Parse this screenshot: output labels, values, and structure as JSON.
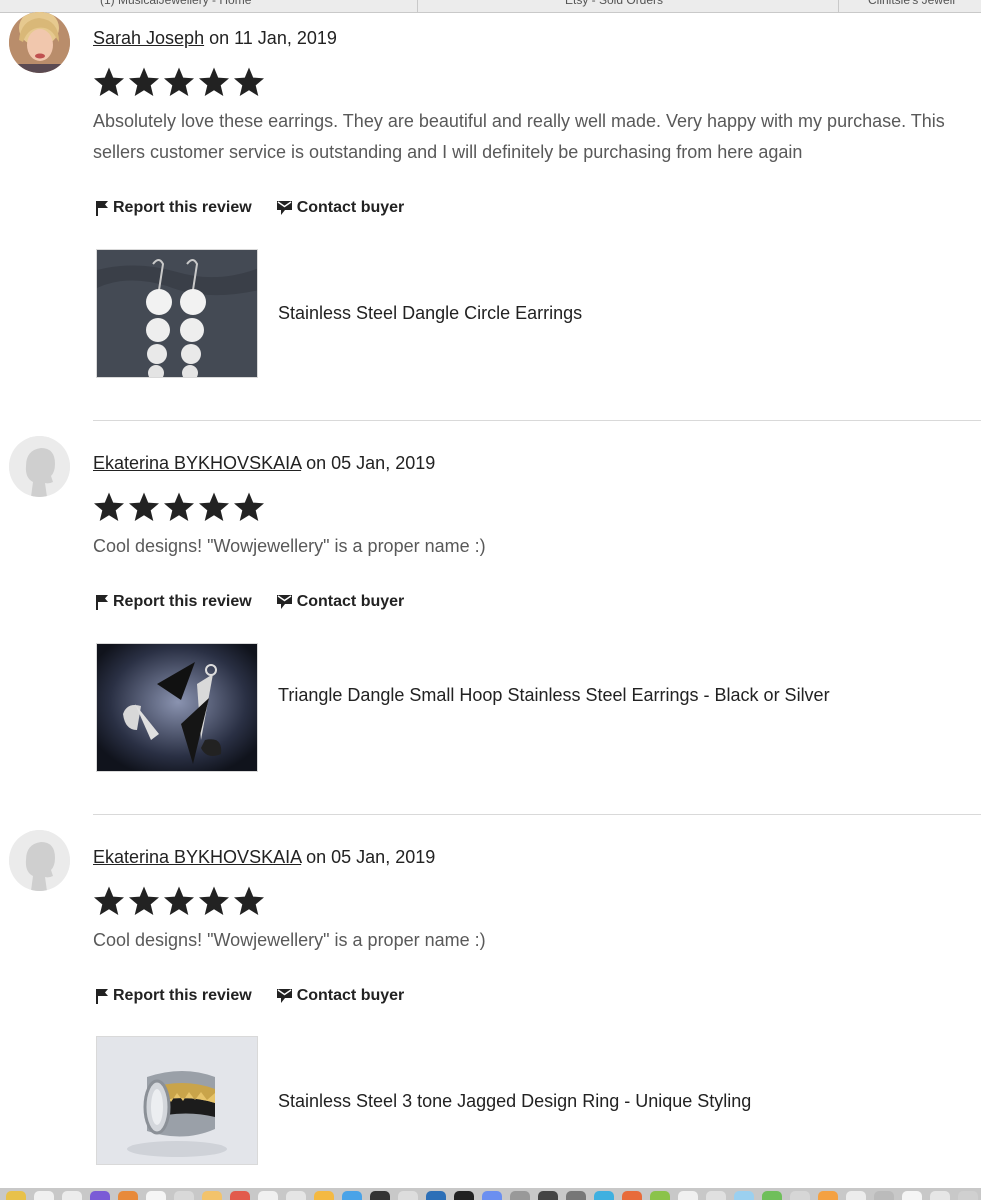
{
  "browser": {
    "tabs": [
      {
        "label": "(1) MusicalJewellery - Home"
      },
      {
        "label": "Etsy - Sold Orders"
      },
      {
        "label": "Clinitsie's Jewell"
      }
    ]
  },
  "reviews": [
    {
      "reviewer": "Sarah Joseph",
      "date_text": "on 11 Jan, 2019",
      "rating": 5,
      "text": "Absolutely love these earrings. They are beautiful and really well made. Very happy with my purchase. This sellers customer service is outstanding and I will definitely be purchasing from here again",
      "report_label": "Report this review",
      "contact_label": "Contact buyer",
      "product_title": "Stainless Steel Dangle Circle Earrings"
    },
    {
      "reviewer": "Ekaterina BYKHOVSKAIA",
      "date_text": "on 05 Jan, 2019",
      "rating": 5,
      "text": "Cool designs! \"Wowjewellery\" is a proper name :)",
      "report_label": "Report this review",
      "contact_label": "Contact buyer",
      "product_title": "Triangle Dangle Small Hoop Stainless Steel Earrings - Black or Silver"
    },
    {
      "reviewer": "Ekaterina BYKHOVSKAIA",
      "date_text": "on 05 Jan, 2019",
      "rating": 5,
      "text": "Cool designs! \"Wowjewellery\" is a proper name :)",
      "report_label": "Report this review",
      "contact_label": "Contact buyer",
      "product_title": "Stainless Steel 3 tone Jagged Design Ring - Unique Styling"
    }
  ],
  "colors": {
    "star": "#222222",
    "review_text": "#595959",
    "divider": "#d9d9d9"
  }
}
